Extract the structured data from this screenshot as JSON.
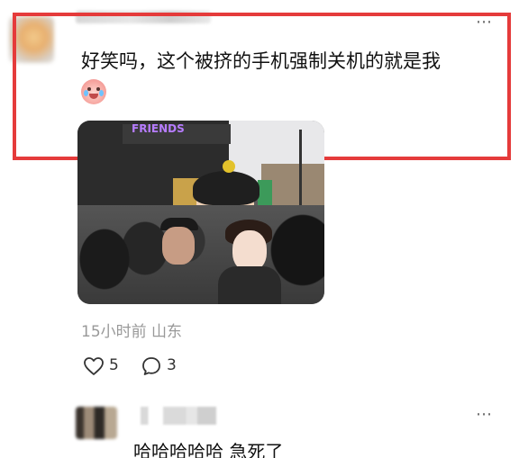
{
  "comment": {
    "text": "好笑吗，这个被挤的手机强制关机的就是我",
    "emoji_icon": "crying-laugh-emoji",
    "meta": "15小时前 山东",
    "likes": "5",
    "replies": "3"
  },
  "icons": {
    "more": "⋯"
  },
  "reply": {
    "text": "哈哈哈哈哈 急死了"
  },
  "colors": {
    "highlight": "#e53b3b",
    "meta_text": "#999999"
  }
}
